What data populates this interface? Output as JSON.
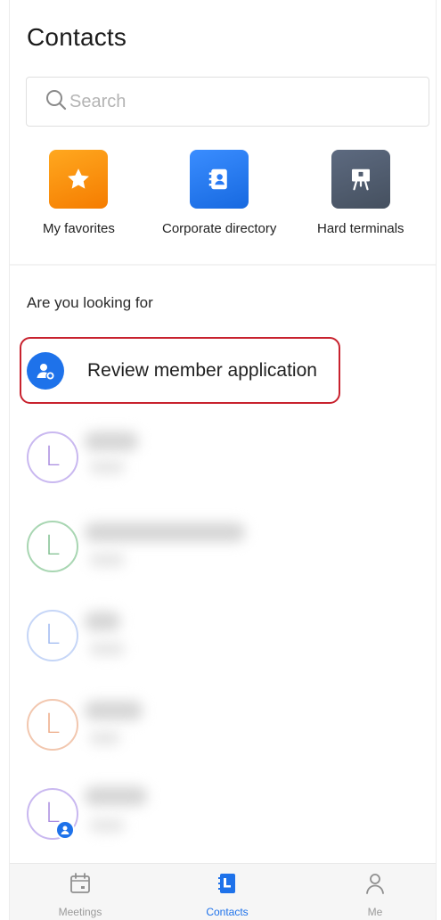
{
  "header": {
    "title": "Contacts"
  },
  "search": {
    "placeholder": "Search"
  },
  "shortcuts": [
    {
      "label": "My favorites",
      "icon": "star-icon",
      "color": "#F7931E"
    },
    {
      "label": "Corporate directory",
      "icon": "contact-book-icon",
      "color": "#2A7BF4"
    },
    {
      "label": "Hard terminals",
      "icon": "terminal-board-icon",
      "color": "#525E70"
    }
  ],
  "suggestions": {
    "title": "Are you looking for",
    "review": {
      "label": "Review member application",
      "icon": "user-add-icon",
      "highlight_color": "#C8222E"
    }
  },
  "contacts": [
    {
      "initial": "L",
      "avatar_color": "#A88BE0"
    },
    {
      "initial": "L",
      "avatar_color": "#7FBF8F"
    },
    {
      "initial": "L",
      "avatar_color": "#9DB8F0"
    },
    {
      "initial": "L",
      "avatar_color": "#EDAA86"
    },
    {
      "initial": "L",
      "avatar_color": "#A88BE0",
      "badge": "user-badge-icon"
    }
  ],
  "tabbar": {
    "tabs": [
      {
        "label": "Meetings",
        "icon": "calendar-icon",
        "active": false
      },
      {
        "label": "Contacts",
        "icon": "contacts-book-icon",
        "active": true
      },
      {
        "label": "Me",
        "icon": "person-icon",
        "active": false
      }
    ],
    "active_color": "#1E72EA"
  }
}
